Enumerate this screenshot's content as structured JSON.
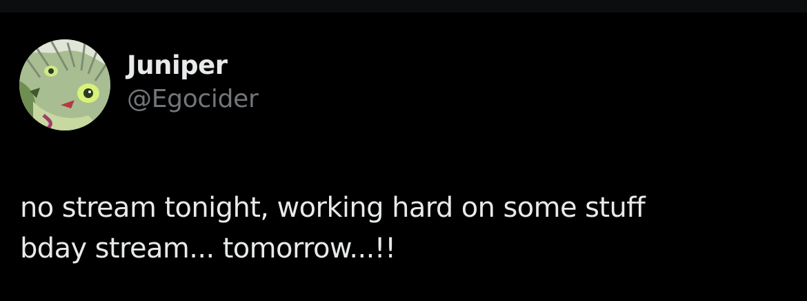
{
  "tweet": {
    "author": {
      "display_name": "Juniper",
      "handle": "@Egocider",
      "avatar_description": "anime-style green illustrated face"
    },
    "text_lines": [
      "no stream tonight, working hard on some stuff",
      "bday stream... tomorrow...!!"
    ]
  },
  "colors": {
    "background": "#000000",
    "primary_text": "#e7e9ea",
    "secondary_text": "#71767b"
  }
}
